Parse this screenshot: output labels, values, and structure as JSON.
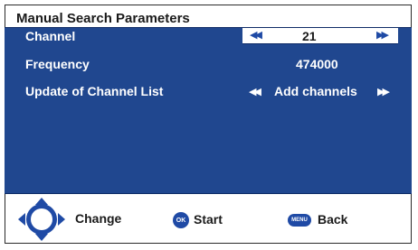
{
  "title": "Manual Search Parameters",
  "settings": [
    {
      "label": "Channel",
      "value": "21",
      "selected": true,
      "left_arrow": "◀◀",
      "right_arrow": "▶▶"
    },
    {
      "label": "Frequency",
      "value": "474000",
      "selected": false
    },
    {
      "label": "Update of Channel List",
      "value": "Add channels",
      "selected": false,
      "left_arrow": "◀◀",
      "right_arrow": "▶▶"
    }
  ],
  "footer": {
    "dpad_icon": "dpad-icon",
    "dpad_label": "Change",
    "ok_button_text": "OK",
    "ok_label": "Start",
    "menu_button_text": "MENU",
    "menu_label": "Back"
  },
  "colors": {
    "panel": "#20478f",
    "accent": "#1f4aa5",
    "selection": "#ffffff",
    "text_dark": "#1a1a1a"
  }
}
